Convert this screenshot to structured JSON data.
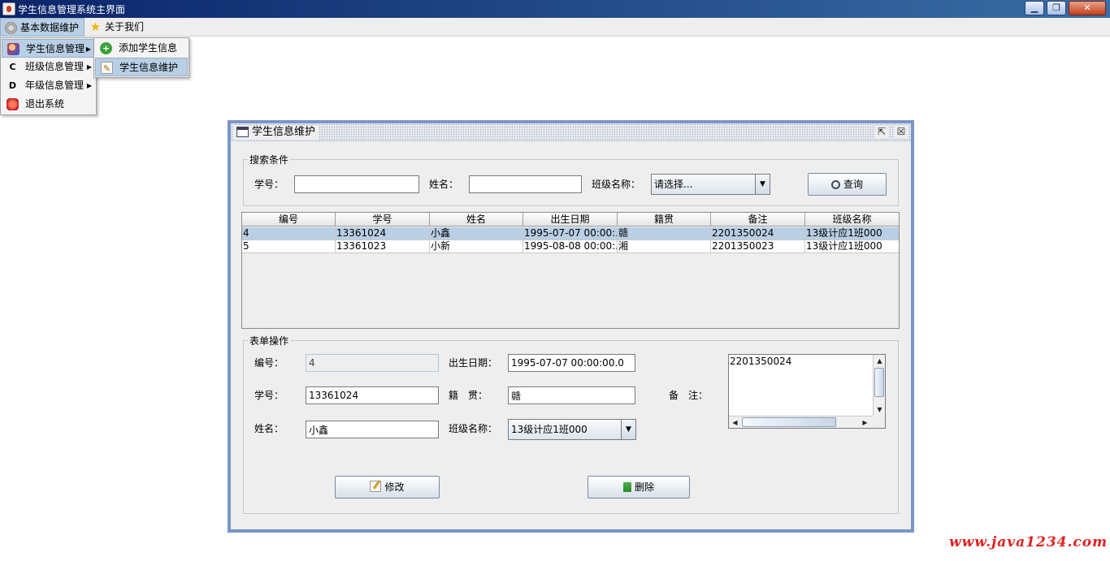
{
  "window": {
    "title": "学生信息管理系统主界面",
    "min_label": "▁",
    "max_label": "❐",
    "close_label": "✕"
  },
  "menubar": {
    "items": [
      {
        "label": "基本数据维护",
        "icon": "gear-icon"
      },
      {
        "label": "关于我们",
        "icon": "star-icon"
      }
    ]
  },
  "main_menu": {
    "items": [
      {
        "label": "学生信息管理",
        "icon": "student-icon",
        "has_submenu": true
      },
      {
        "label": "班级信息管理",
        "icon": "C",
        "has_submenu": true
      },
      {
        "label": "年级信息管理",
        "icon": "D",
        "has_submenu": true
      },
      {
        "label": "退出系统",
        "icon": "exit-icon",
        "has_submenu": false
      }
    ],
    "arrow": "▶"
  },
  "sub_menu": {
    "items": [
      {
        "label": "添加学生信息",
        "icon": "plus-icon"
      },
      {
        "label": "学生信息维护",
        "icon": "edit-icon"
      }
    ]
  },
  "frame": {
    "title": "学生信息维护",
    "restore_label": "⇱",
    "close_label": "☒"
  },
  "search": {
    "legend": "搜索条件",
    "student_no_label": "学号：",
    "student_no_value": "",
    "name_label": "姓名：",
    "name_value": "",
    "class_label": "班级名称：",
    "class_selected": "请选择...",
    "query_button": "查询",
    "dropdown_arrow": "▼"
  },
  "table": {
    "columns": [
      "编号",
      "学号",
      "姓名",
      "出生日期",
      "籍贯",
      "备注",
      "班级名称"
    ],
    "rows": [
      [
        "4",
        "13361024",
        "小鑫",
        "1995-07-07 00:00:...",
        "赣",
        "2201350024",
        "13级计应1班000"
      ],
      [
        "5",
        "13361023",
        "小新",
        "1995-08-08 00:00:...",
        "湘",
        "2201350023",
        "13级计应1班000"
      ]
    ],
    "selected_row": 0
  },
  "form": {
    "legend": "表单操作",
    "id_label": "编号：",
    "id_value": "4",
    "birth_label": "出生日期：",
    "birth_value": "1995-07-07 00:00:00.0",
    "student_no_label": "学号：",
    "student_no_value": "13361024",
    "native_label": "籍　贯：",
    "native_value": "赣",
    "memo_label": "备　注：",
    "memo_value": "2201350024",
    "name_label": "姓名：",
    "name_value": "小鑫",
    "class_label": "班级名称：",
    "class_selected": "13级计应1班000",
    "modify_button": "修改",
    "delete_button": "删除"
  },
  "watermark": "www.java1234.com",
  "colors": {
    "frame_border": "#7a96c8",
    "selection": "#b8cfe5",
    "watermark": "#e02020"
  }
}
